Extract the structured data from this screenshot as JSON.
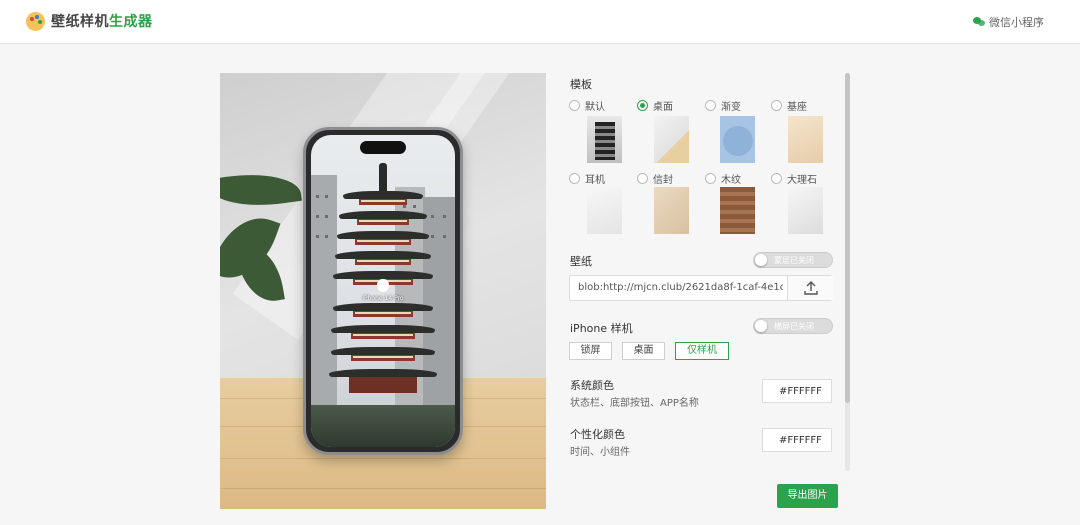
{
  "header": {
    "title_part1": "壁纸样机",
    "title_part2": "生成器",
    "wechat_label": "微信小程序"
  },
  "preview": {
    "phone_caption": "iPhone 14 Pro"
  },
  "template": {
    "label": "模板",
    "options": [
      {
        "label": "默认",
        "selected": false
      },
      {
        "label": "桌面",
        "selected": true
      },
      {
        "label": "渐变",
        "selected": false
      },
      {
        "label": "基座",
        "selected": false
      },
      {
        "label": "耳机",
        "selected": false
      },
      {
        "label": "信封",
        "selected": false
      },
      {
        "label": "木纹",
        "selected": false
      },
      {
        "label": "大理石",
        "selected": false
      }
    ]
  },
  "wallpaper": {
    "label": "壁纸",
    "toggle_label": "蒙层已关闭",
    "toggle_on": false,
    "url_value": "blob:http://mjcn.club/2621da8f-1caf-4e1c"
  },
  "iphone": {
    "label": "iPhone 样机",
    "toggle_label": "横屏已关闭",
    "toggle_on": false,
    "modes": [
      {
        "label": "锁屏",
        "active": false
      },
      {
        "label": "桌面",
        "active": false
      },
      {
        "label": "仅样机",
        "active": true
      }
    ]
  },
  "system_color": {
    "label": "系统颜色",
    "sub": "状态栏、底部按钮、APP名称",
    "value": "#FFFFFF"
  },
  "custom_color": {
    "label": "个性化颜色",
    "sub": "时间、小组件",
    "value": "#FFFFFF"
  },
  "export_label": "导出图片",
  "colors": {
    "accent": "#2ba24c"
  }
}
